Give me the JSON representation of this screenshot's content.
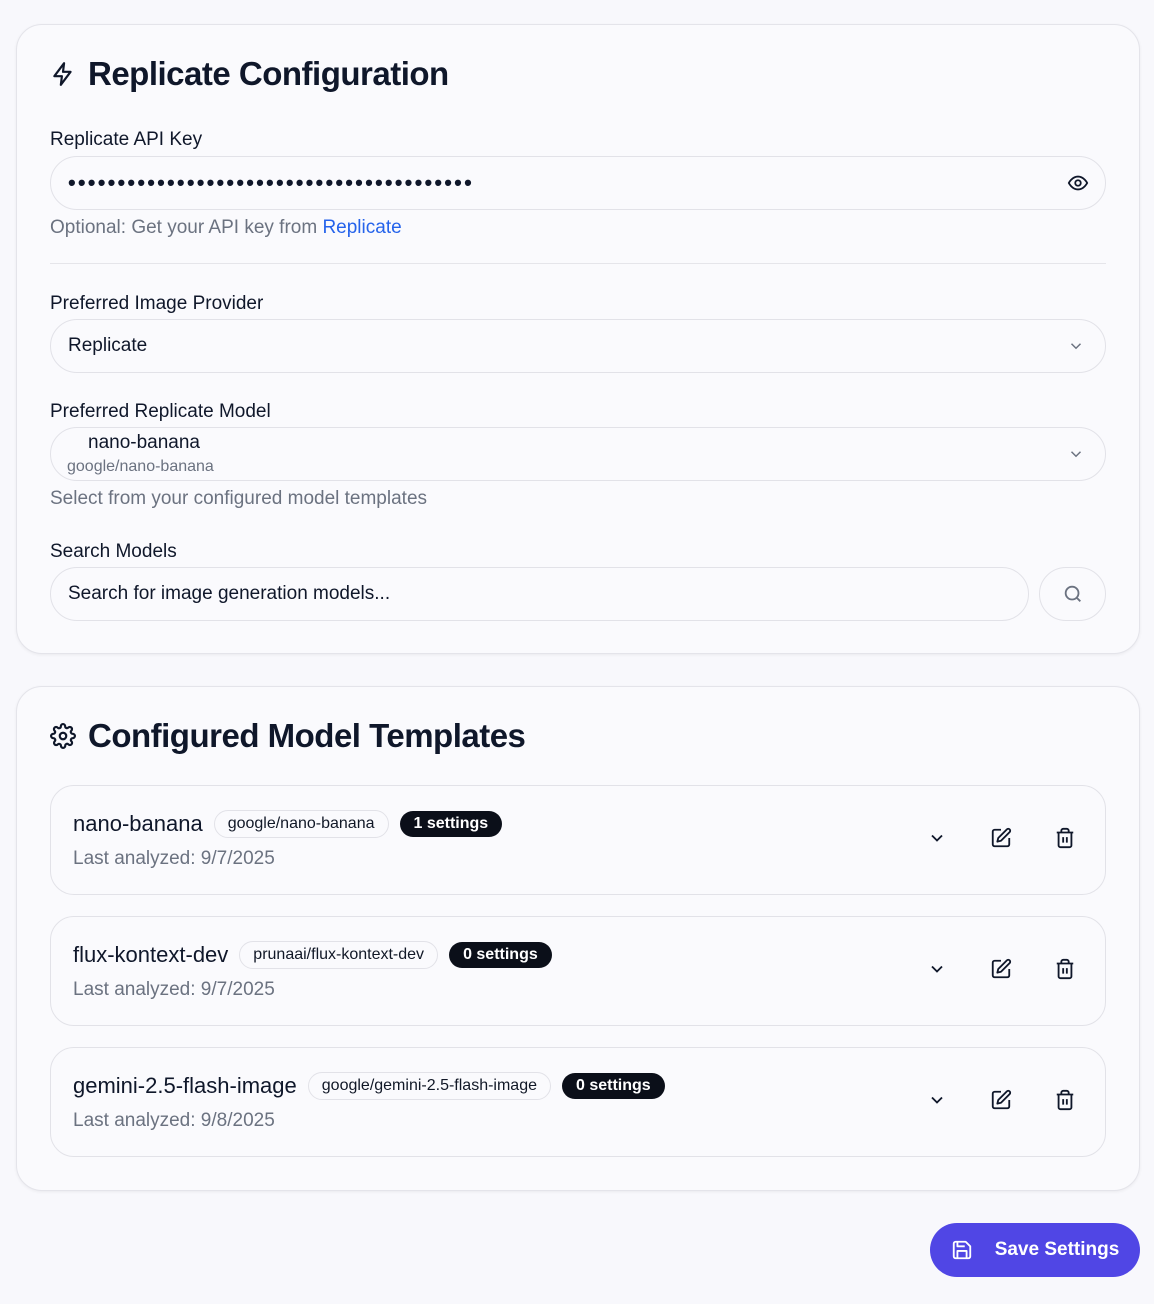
{
  "config": {
    "title": "Replicate Configuration",
    "title_icon": "lightning-icon",
    "api_key": {
      "label": "Replicate API Key",
      "masked_value": "•••••••••••••••••••••••••••••••••••••••••",
      "helper_prefix": "Optional: Get your API key from",
      "helper_link": "Replicate"
    },
    "provider": {
      "label": "Preferred Image Provider",
      "value": "Replicate"
    },
    "model": {
      "label": "Preferred Replicate Model",
      "name": "nano-banana",
      "path": "google/nano-banana",
      "helper": "Select from your configured model templates"
    },
    "search": {
      "label": "Search Models",
      "placeholder": "Search for image generation models..."
    }
  },
  "templates": {
    "title": "Configured Model Templates",
    "title_icon": "gear-icon",
    "items": [
      {
        "name": "nano-banana",
        "path": "google/nano-banana",
        "badge": "1 settings",
        "date": "Last analyzed: 9/7/2025"
      },
      {
        "name": "flux-kontext-dev",
        "path": "prunaai/flux-kontext-dev",
        "badge": "0 settings",
        "date": "Last analyzed: 9/7/2025"
      },
      {
        "name": "gemini-2.5-flash-image",
        "path": "google/gemini-2.5-flash-image",
        "badge": "0 settings",
        "date": "Last analyzed: 9/8/2025"
      }
    ]
  },
  "save_button": {
    "label": "Save Settings",
    "icon": "save-icon"
  },
  "colors": {
    "accent": "#5046e5",
    "link": "#2563eb",
    "badge": "#0b0f19"
  }
}
